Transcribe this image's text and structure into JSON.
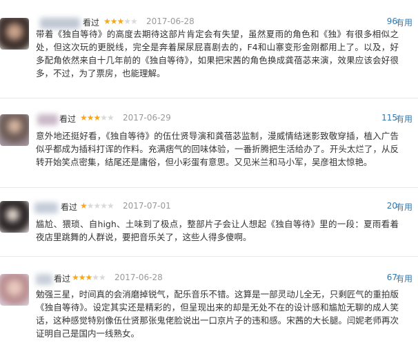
{
  "reviews": [
    {
      "watched_label": "看过",
      "rating": 3,
      "rating_max": 5,
      "date": "2017-06-28",
      "votes": "96",
      "useful_label": "有用",
      "text": "带着《独自等待》的高度去期待这部片肯定会有失望，虽然夏雨的角色和《独》有很多相似之处，但这次玩的更脱线，完全是奔着屎尿屁喜剧去的，F4和山寨变形金刚都用上了。以及，好多配角依然来自十几年前的《独自等待》，如果把宋茜的角色换成龚蓓苾来演，效果应该会好很多，不过，为了票房，也能理解。"
    },
    {
      "watched_label": "看过",
      "rating": 3,
      "rating_max": 5,
      "date": "2017-06-29",
      "votes": "115",
      "useful_label": "有用",
      "text": "意外地还挺好看，《独自等待》的伍仕贤导演和龚蓓苾监制，漫威情结迷影致敬穿插，植入广告似乎都成为插科打诨的作料。充满痞气的回味体验，一番折腾把生活给办了。开头太烂了，从反转开始笑点密集，结尾还是庸俗，但小彩蛋有意思。又见米兰和马小军，吴彦祖太惊艳。"
    },
    {
      "watched_label": "看过",
      "rating": 1,
      "rating_max": 5,
      "date": "2017-07-01",
      "votes": "20",
      "useful_label": "有用",
      "text": "尴尬、猥琐、自high、土味到了极点，整部片子会让人想起《独自等待》里的一段：夏雨看着夜店里跳舞的人群说，要把音乐关了，这些人得多傻啊。"
    },
    {
      "watched_label": "看过",
      "rating": 3,
      "rating_max": 5,
      "date": "2017-06-28",
      "votes": "67",
      "useful_label": "有用",
      "text": "勉强三星，时间真的会消磨掉锐气，配乐音乐不错。这算是一部灵动儿全无，只剩匠气的重拍版《独自等待》。设定其实还是精彩的，但呈现出来的却是无处不在的设计感和尴尬无聊的成人笑话，这种感觉特别像伍仕贤那张鬼佬脸说出一口京片子的违和感。宋茜的大长腿。闫妮老师再次证明自己是国内一线熟女。"
    }
  ],
  "colors": {
    "star_on": "#f4a81c",
    "star_off": "#d9d9d9",
    "link": "#3377aa",
    "date": "#999999"
  }
}
